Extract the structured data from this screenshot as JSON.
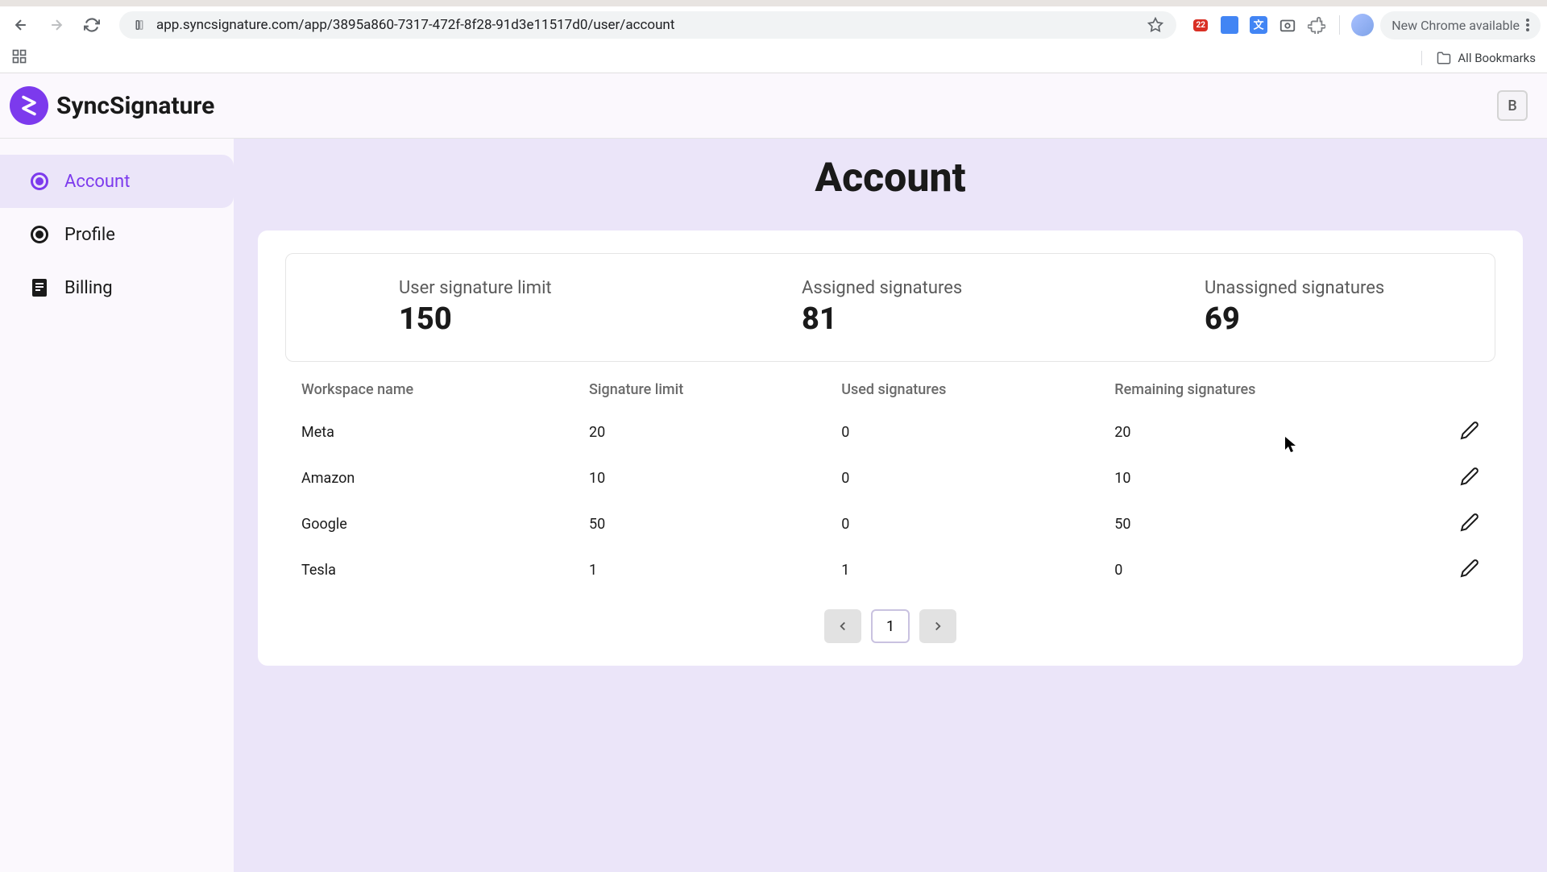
{
  "browser": {
    "url": "app.syncsignature.com/app/3895a860-7317-472f-8f28-91d3e11517d0/user/account",
    "update_label": "New Chrome available",
    "all_bookmarks": "All Bookmarks",
    "calendar_badge": "22"
  },
  "header": {
    "brand_name": "SyncSignature",
    "user_initial": "B"
  },
  "sidebar": {
    "items": [
      {
        "label": "Account",
        "active": true
      },
      {
        "label": "Profile",
        "active": false
      },
      {
        "label": "Billing",
        "active": false
      }
    ]
  },
  "page": {
    "title": "Account",
    "stats": [
      {
        "label": "User signature limit",
        "value": "150"
      },
      {
        "label": "Assigned signatures",
        "value": "81"
      },
      {
        "label": "Unassigned signatures",
        "value": "69"
      }
    ],
    "table": {
      "headers": [
        "Workspace name",
        "Signature limit",
        "Used signatures",
        "Remaining signatures"
      ],
      "rows": [
        {
          "name": "Meta",
          "limit": "20",
          "used": "0",
          "remaining": "20"
        },
        {
          "name": "Amazon",
          "limit": "10",
          "used": "0",
          "remaining": "10"
        },
        {
          "name": "Google",
          "limit": "50",
          "used": "0",
          "remaining": "50"
        },
        {
          "name": "Tesla",
          "limit": "1",
          "used": "1",
          "remaining": "0"
        }
      ]
    },
    "pagination": {
      "current": "1"
    }
  }
}
